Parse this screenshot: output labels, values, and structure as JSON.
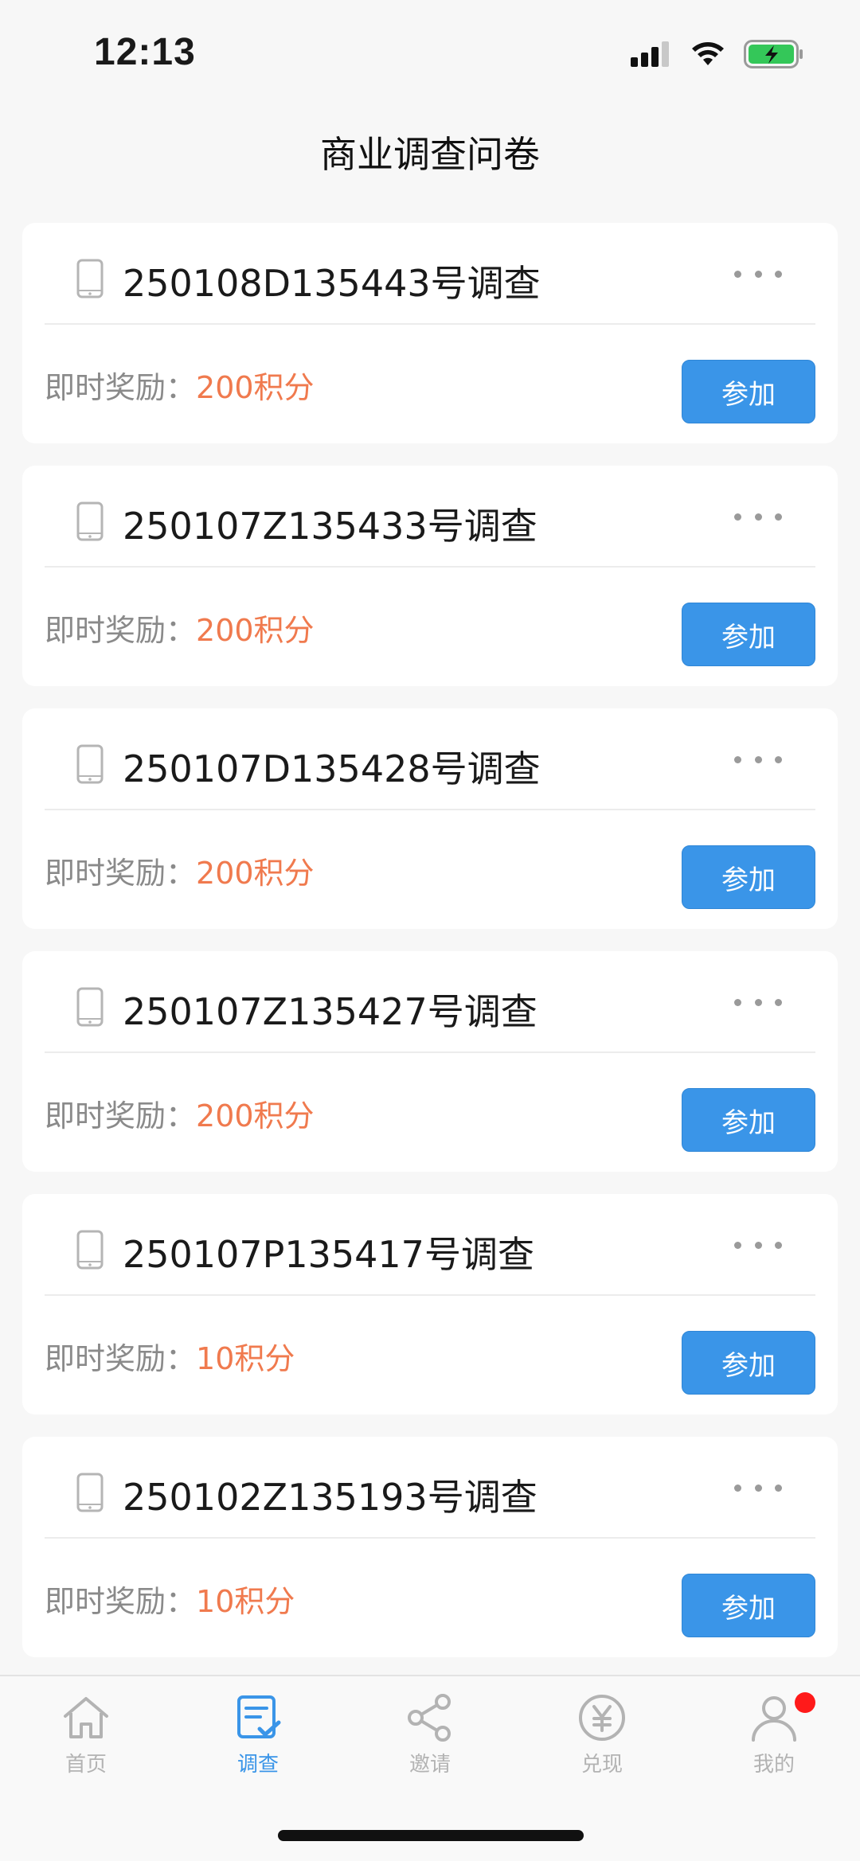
{
  "status_bar": {
    "time": "12:13",
    "icons": [
      "cellular-signal-icon",
      "wifi-icon",
      "battery-charging-icon"
    ]
  },
  "header": {
    "title": "商业调查问卷"
  },
  "surveys": [
    {
      "title": "250108D135443号调查",
      "reward_label": "即时奖励：",
      "reward_value": "200积分",
      "button": "参加"
    },
    {
      "title": "250107Z135433号调查",
      "reward_label": "即时奖励：",
      "reward_value": "200积分",
      "button": "参加"
    },
    {
      "title": "250107D135428号调查",
      "reward_label": "即时奖励：",
      "reward_value": "200积分",
      "button": "参加"
    },
    {
      "title": "250107Z135427号调查",
      "reward_label": "即时奖励：",
      "reward_value": "200积分",
      "button": "参加"
    },
    {
      "title": "250107P135417号调查",
      "reward_label": "即时奖励：",
      "reward_value": "10积分",
      "button": "参加"
    },
    {
      "title": "250102Z135193号调查",
      "reward_label": "即时奖励：",
      "reward_value": "10积分",
      "button": "参加"
    }
  ],
  "tabbar": {
    "items": [
      {
        "label": "首页",
        "icon": "home-icon",
        "active": false
      },
      {
        "label": "调查",
        "icon": "survey-icon",
        "active": true
      },
      {
        "label": "邀请",
        "icon": "share-icon",
        "active": false
      },
      {
        "label": "兑现",
        "icon": "yuan-coin-icon",
        "active": false
      },
      {
        "label": "我的",
        "icon": "profile-icon",
        "active": false
      }
    ]
  },
  "colors": {
    "accent": "#3a95e8",
    "reward": "#f07a4e",
    "badge": "#ff1a1a",
    "background": "#f7f7f7"
  }
}
